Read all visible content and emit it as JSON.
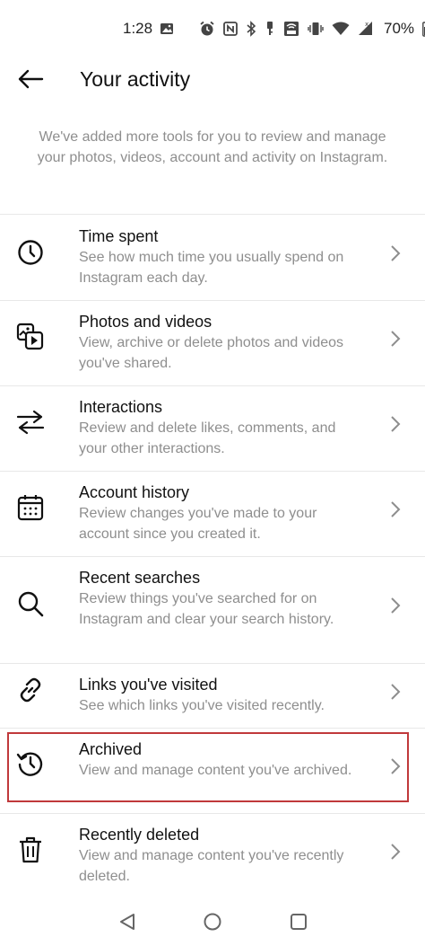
{
  "status_bar": {
    "time": "1:28",
    "battery": "70%",
    "icons": [
      "image-icon",
      "alarm-icon",
      "nfc-icon",
      "bluetooth-icon",
      "key-icon",
      "wifi-calling-icon",
      "vibrate-icon",
      "wifi-icon",
      "signal-icon",
      "battery-icon"
    ]
  },
  "header": {
    "back_icon": "arrow-left-icon",
    "title": "Your activity"
  },
  "intro": "We've added more tools for you to review and manage your photos, videos, account and activity on Instagram.",
  "items": [
    {
      "icon": "clock-icon",
      "title": "Time spent",
      "description": "See how much time you usually spend on Instagram each day."
    },
    {
      "icon": "photos-videos-icon",
      "title": "Photos and videos",
      "description": "View, archive or delete photos and videos you've shared."
    },
    {
      "icon": "arrows-exchange-icon",
      "title": "Interactions",
      "description": "Review and delete likes, comments, and your other interactions."
    },
    {
      "icon": "calendar-icon",
      "title": "Account history",
      "description": "Review changes you've made to your account since you created it."
    },
    {
      "icon": "search-icon",
      "title": "Recent searches",
      "description": "Review things you've searched for on Instagram and clear your search history."
    },
    {
      "icon": "link-icon",
      "title": "Links you've visited",
      "description": "See which links you've visited recently."
    },
    {
      "icon": "archive-history-icon",
      "title": "Archived",
      "description": "View and manage content you've archived.",
      "highlighted": true
    },
    {
      "icon": "trash-icon",
      "title": "Recently deleted",
      "description": "View and manage content you've recently deleted."
    }
  ],
  "highlight_color": "#c0393b",
  "nav_bar": {
    "icons": [
      "back-triangle-icon",
      "home-circle-icon",
      "recents-square-icon"
    ]
  }
}
